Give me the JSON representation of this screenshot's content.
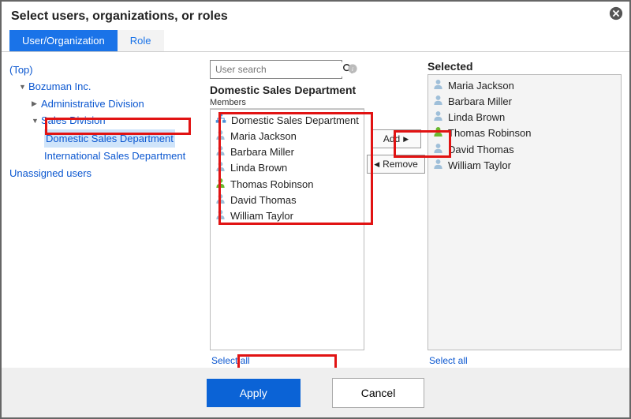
{
  "dialog": {
    "title": "Select users, organizations, or roles"
  },
  "tabs": {
    "user_org": "User/Organization",
    "role": "Role"
  },
  "tree": {
    "top": "(Top)",
    "levels": [
      {
        "label": "Bozuman Inc."
      },
      {
        "label": "Administrative Division"
      },
      {
        "label": "Sales Division"
      },
      {
        "label": "Domestic Sales Department"
      },
      {
        "label": "International Sales Department"
      }
    ],
    "unassigned": "Unassigned users"
  },
  "search": {
    "placeholder": "User search"
  },
  "members_panel": {
    "heading": "Domestic Sales Department",
    "label": "Members",
    "items": [
      {
        "type": "org",
        "name": "Domestic Sales Department"
      },
      {
        "type": "user",
        "name": "Maria Jackson"
      },
      {
        "type": "user",
        "name": "Barbara Miller"
      },
      {
        "type": "user",
        "name": "Linda Brown"
      },
      {
        "type": "user-active",
        "name": "Thomas Robinson"
      },
      {
        "type": "user",
        "name": "David Thomas"
      },
      {
        "type": "user",
        "name": "William Taylor"
      }
    ],
    "select_all": "Select all"
  },
  "transfer": {
    "add": "Add",
    "remove": "Remove"
  },
  "selected_panel": {
    "heading": "Selected",
    "items": [
      {
        "type": "user",
        "name": "Maria Jackson"
      },
      {
        "type": "user",
        "name": "Barbara Miller"
      },
      {
        "type": "user",
        "name": "Linda Brown"
      },
      {
        "type": "user-active",
        "name": "Thomas Robinson"
      },
      {
        "type": "user",
        "name": "David Thomas"
      },
      {
        "type": "user",
        "name": "William Taylor"
      }
    ],
    "select_all": "Select all"
  },
  "footer": {
    "apply": "Apply",
    "cancel": "Cancel"
  }
}
